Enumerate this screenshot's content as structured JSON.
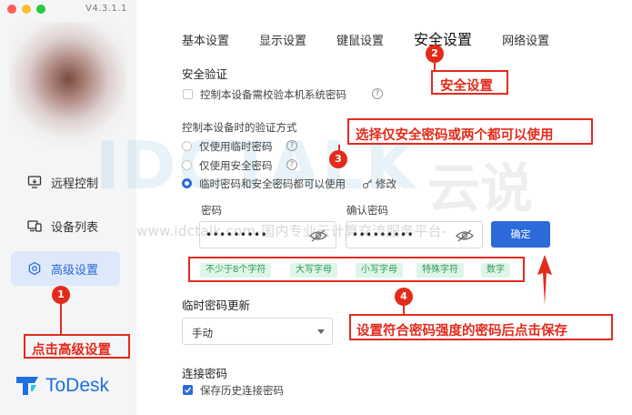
{
  "app": {
    "version": "V4.3.1.1",
    "logo_text": "ToDesk"
  },
  "sidebar": {
    "items": [
      {
        "label": "远程控制",
        "icon": "monitor-icon"
      },
      {
        "label": "设备列表",
        "icon": "devices-icon"
      },
      {
        "label": "高级设置",
        "icon": "settings-hexagon-icon",
        "active": true
      }
    ]
  },
  "tabs": [
    "基本设置",
    "显示设置",
    "键鼠设置",
    "安全设置",
    "网络设置"
  ],
  "active_tab": "安全设置",
  "security": {
    "title": "安全验证",
    "verify_local_password_label": "控制本设备需校验本机系统密码",
    "method_title": "控制本设备时的验证方式",
    "options": [
      {
        "label": "仅使用临时密码",
        "selected": false
      },
      {
        "label": "仅使用安全密码",
        "selected": false
      },
      {
        "label": "临时密码和安全密码都可以使用",
        "selected": true
      }
    ],
    "modify_label": "修改",
    "password_label": "密码",
    "confirm_password_label": "确认密码",
    "password_value": "•••••••••",
    "confirm_password_value": "•••••••••",
    "confirm_button": "确定",
    "strength_tags": [
      "不少于8个字符",
      "大写字母",
      "小写字母",
      "特殊字符",
      "数字"
    ]
  },
  "temp_password": {
    "title": "临时密码更新",
    "select_value": "手动"
  },
  "connection_password": {
    "title": "连接密码",
    "save_history_label": "保存历史连接密码",
    "save_history_checked": true
  },
  "annotations": {
    "step1_number": "1",
    "step1_text": "点击高级设置",
    "step2_number": "2",
    "step2_text": "安全设置",
    "step3_number": "3",
    "step3_text": "选择仅安全密码或两个都可以使用",
    "step4_number": "4",
    "step4_text": "设置符合密码强度的密码后点击保存"
  },
  "watermark": {
    "logo": "IDCTALK",
    "logo_cn": "云说",
    "text": "www.idctalk.com-国内专业云计算交流服务平台-"
  },
  "colors": {
    "accent": "#2b6ad8",
    "annotation_red": "#e32b1c",
    "tag_bg": "#dff5e8",
    "tag_text": "#2b9a57"
  }
}
